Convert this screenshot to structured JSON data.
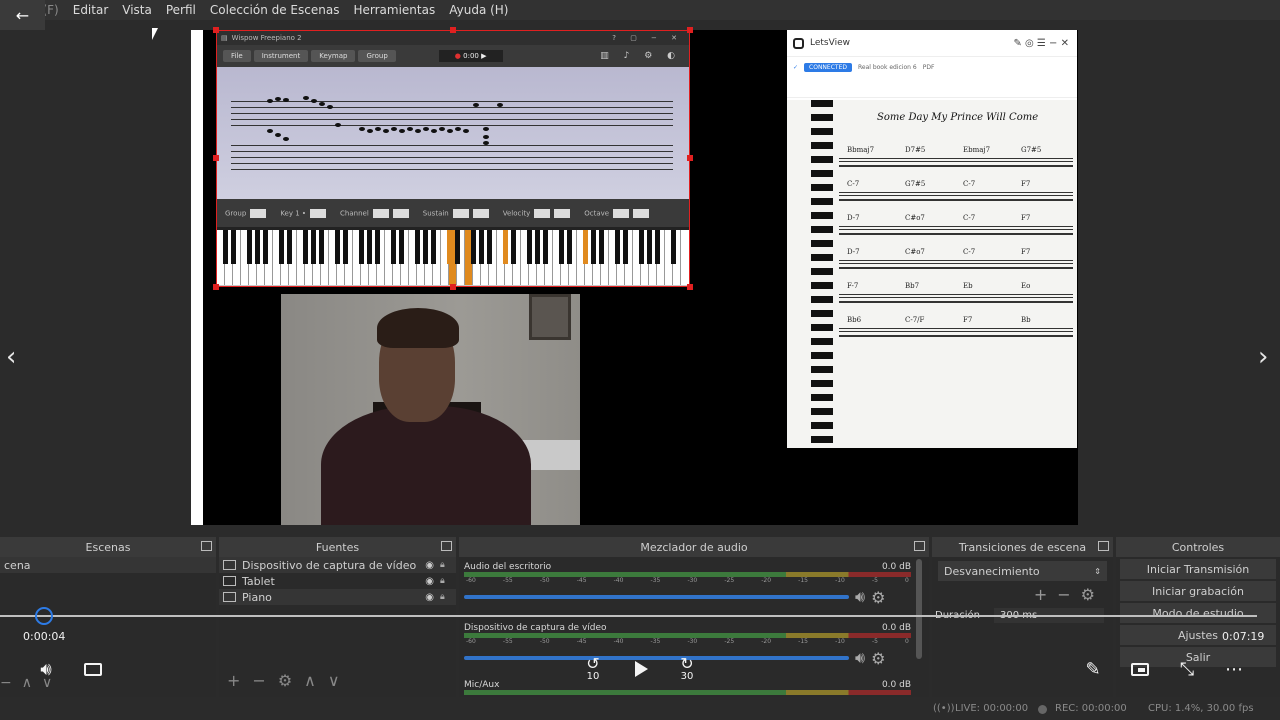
{
  "menu": {
    "items": [
      "rchivo (F)",
      "Editar",
      "Vista",
      "Perfil",
      "Colección de Escenas",
      "Herramientas",
      "Ayuda (H)"
    ]
  },
  "piano": {
    "title": "Wispow Freepiano 2",
    "buttons": [
      "File",
      "Instrument",
      "Keymap",
      "Group"
    ],
    "time": "0:00",
    "controls": [
      "Group",
      "Key 1 •",
      "Channel",
      "Sustain",
      "Velocity",
      "Octave"
    ],
    "control_values": [
      "0",
      "C/0",
      "0",
      "0",
      "127",
      "127",
      "100",
      "100",
      "0",
      "0"
    ]
  },
  "letsview": {
    "app_name": "LetsView",
    "chip": "CONNECTED",
    "file_name": "Real book edicion 6",
    "file_ext": "PDF",
    "song_title": "Some Day My Prince Will Come",
    "chords": [
      [
        "Bbmaj7",
        "D7#5",
        "Ebmaj7",
        "G7#5"
      ],
      [
        "C-7",
        "G7#5",
        "C-7",
        "F7"
      ],
      [
        "D-7",
        "C#o7",
        "C-7",
        "F7"
      ],
      [
        "D-7",
        "C#o7",
        "C-7",
        "F7"
      ],
      [
        "F-7",
        "Bb7",
        "Eb",
        "Eo"
      ],
      [
        "Bb6",
        "C-7/F",
        "F7",
        "Bb"
      ]
    ]
  },
  "docks": {
    "scenes": {
      "title": "Escenas",
      "item": "cena"
    },
    "sources": {
      "title": "Fuentes",
      "items": [
        "Dispositivo de captura de vídeo",
        "Tablet",
        "Piano"
      ]
    },
    "mixer": {
      "title": "Mezclador de audio",
      "channels": [
        {
          "name": "Audio del escritorio",
          "level": "0.0 dB"
        },
        {
          "name": "Dispositivo de captura de vídeo",
          "level": "0.0 dB"
        },
        {
          "name": "Mic/Aux",
          "level": "0.0 dB"
        }
      ],
      "ticks": [
        "-60",
        "-55",
        "-50",
        "-45",
        "-40",
        "-35",
        "-30",
        "-25",
        "-20",
        "-15",
        "-10",
        "-5",
        "0"
      ]
    },
    "transitions": {
      "title": "Transiciones de escena",
      "selected": "Desvanecimiento",
      "duration_label": "Duración",
      "duration_value": "300 ms"
    },
    "controls": {
      "title": "Controles",
      "buttons": [
        "Iniciar Transmisión",
        "Iniciar grabación",
        "Modo de estudio",
        "Ajustes",
        "Salir"
      ]
    }
  },
  "player": {
    "current_time": "0:00:04",
    "total_time": "0:07:19",
    "skip_back": "10",
    "skip_forward": "30",
    "progress": 0.009
  },
  "status": {
    "live": "LIVE: 00:00:00",
    "rec": "REC: 00:00:00",
    "cpu": "CPU: 1.4%, 30.00 fps"
  }
}
